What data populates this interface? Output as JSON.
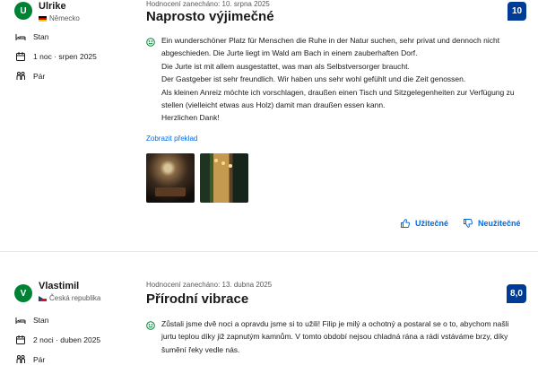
{
  "reviews": [
    {
      "reviewer": {
        "initial": "U",
        "name": "Ulrike",
        "country": "Německo",
        "flag": "de"
      },
      "stay": {
        "room": "Stan",
        "nights_date": "1 noc · srpen 2025",
        "group": "Pár"
      },
      "review_date": "Hodnocení zanecháno: 10. srpna 2025",
      "title": "Naprosto výjimečné",
      "score": "10",
      "text_lines": [
        "Ein wunderschöner Platz für Menschen die Ruhe in der Natur suchen, sehr privat und dennoch nicht abgeschieden. Die Jurte liegt im Wald am Bach in einem zauberhaften Dorf.",
        "Die Jurte ist mit allem ausgestattet, was man als Selbstversorger braucht.",
        "Der Gastgeber ist sehr freundlich. Wir haben uns sehr wohl gefühlt und die Zeit genossen.",
        "Als kleinen Anreiz möchte ich vorschlagen, draußen einen Tisch und Sitzgelegenheiten zur Verfügung zu stellen (vielleicht etwas aus Holz) damit man draußen essen kann.",
        "Herzlichen Dank!"
      ],
      "translate_link": "Zobrazit překlad",
      "helpful_label": "Užitečné",
      "not_helpful_label": "Neužitečné"
    },
    {
      "reviewer": {
        "initial": "V",
        "name": "Vlastimil",
        "country": "Česká republika",
        "flag": "cz"
      },
      "stay": {
        "room": "Stan",
        "nights_date": "2 noci · duben 2025",
        "group": "Pár"
      },
      "review_date": "Hodnocení zanecháno: 13. dubna 2025",
      "title": "Přírodní vibrace",
      "score": "8,0",
      "text_lines": [
        "Zůstali jsme dvě noci a opravdu jsme si to užili! Filip je milý a ochotný a postaral se o to, abychom našli jurtu teplou díky již zapnutým kamnům. V tomto období nejsou chladná rána a rádi vstáváme brzy, díky šumění řeky vedle nás."
      ]
    }
  ]
}
